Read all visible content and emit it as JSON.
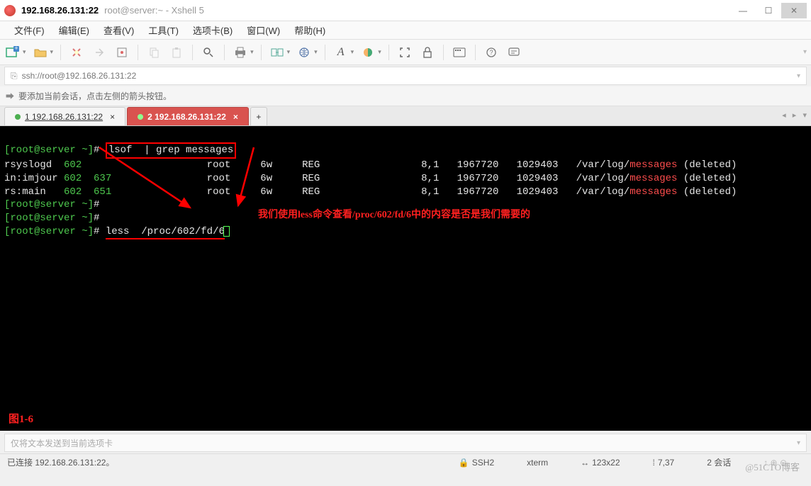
{
  "title": {
    "main": "192.168.26.131:22",
    "sub": "root@server:~ - Xshell 5"
  },
  "menu": [
    "文件(F)",
    "编辑(E)",
    "查看(V)",
    "工具(T)",
    "选项卡(B)",
    "窗口(W)",
    "帮助(H)"
  ],
  "address": "ssh://root@192.168.26.131:22",
  "hint": "要添加当前会话，点击左侧的箭头按钮。",
  "tabs": [
    {
      "label": "1 192.168.26.131:22",
      "active": false
    },
    {
      "label": "2 192.168.26.131:22",
      "active": true
    }
  ],
  "terminal": {
    "prompt_user": "[root@server ~]",
    "prompt_char": "#",
    "cmd1": "lsof  | grep messages",
    "rows": [
      {
        "proc": "rsyslogd",
        "pid": "602",
        "tid": "",
        "user": "root",
        "fd": "6w",
        "type": "REG",
        "dev": "8,1",
        "size": "1967720",
        "node": "1029403",
        "path_pre": "/var/log/",
        "path_hi": "messages",
        "path_post": " (deleted)"
      },
      {
        "proc": "in:imjour",
        "pid": "602",
        "tid": "637",
        "user": "root",
        "fd": "6w",
        "type": "REG",
        "dev": "8,1",
        "size": "1967720",
        "node": "1029403",
        "path_pre": "/var/log/",
        "path_hi": "messages",
        "path_post": " (deleted)"
      },
      {
        "proc": "rs:main",
        "pid": "602",
        "tid": "651",
        "user": "root",
        "fd": "6w",
        "type": "REG",
        "dev": "8,1",
        "size": "1967720",
        "node": "1029403",
        "path_pre": "/var/log/",
        "path_hi": "messages",
        "path_post": " (deleted)"
      }
    ],
    "cmd2": "less  /proc/602/fd/6",
    "annotation": "我们使用less命令查看/proc/602/fd/6中的内容是否是我们需要的",
    "figlabel": "图1-6"
  },
  "input_placeholder": "仅将文本发送到当前选项卡",
  "status": {
    "left": "已连接 192.168.26.131:22。",
    "ssh": "SSH2",
    "term": "xterm",
    "size": "123x22",
    "pos": "7,37",
    "sessions": "2 会话"
  },
  "watermark": "@51CTO博客"
}
